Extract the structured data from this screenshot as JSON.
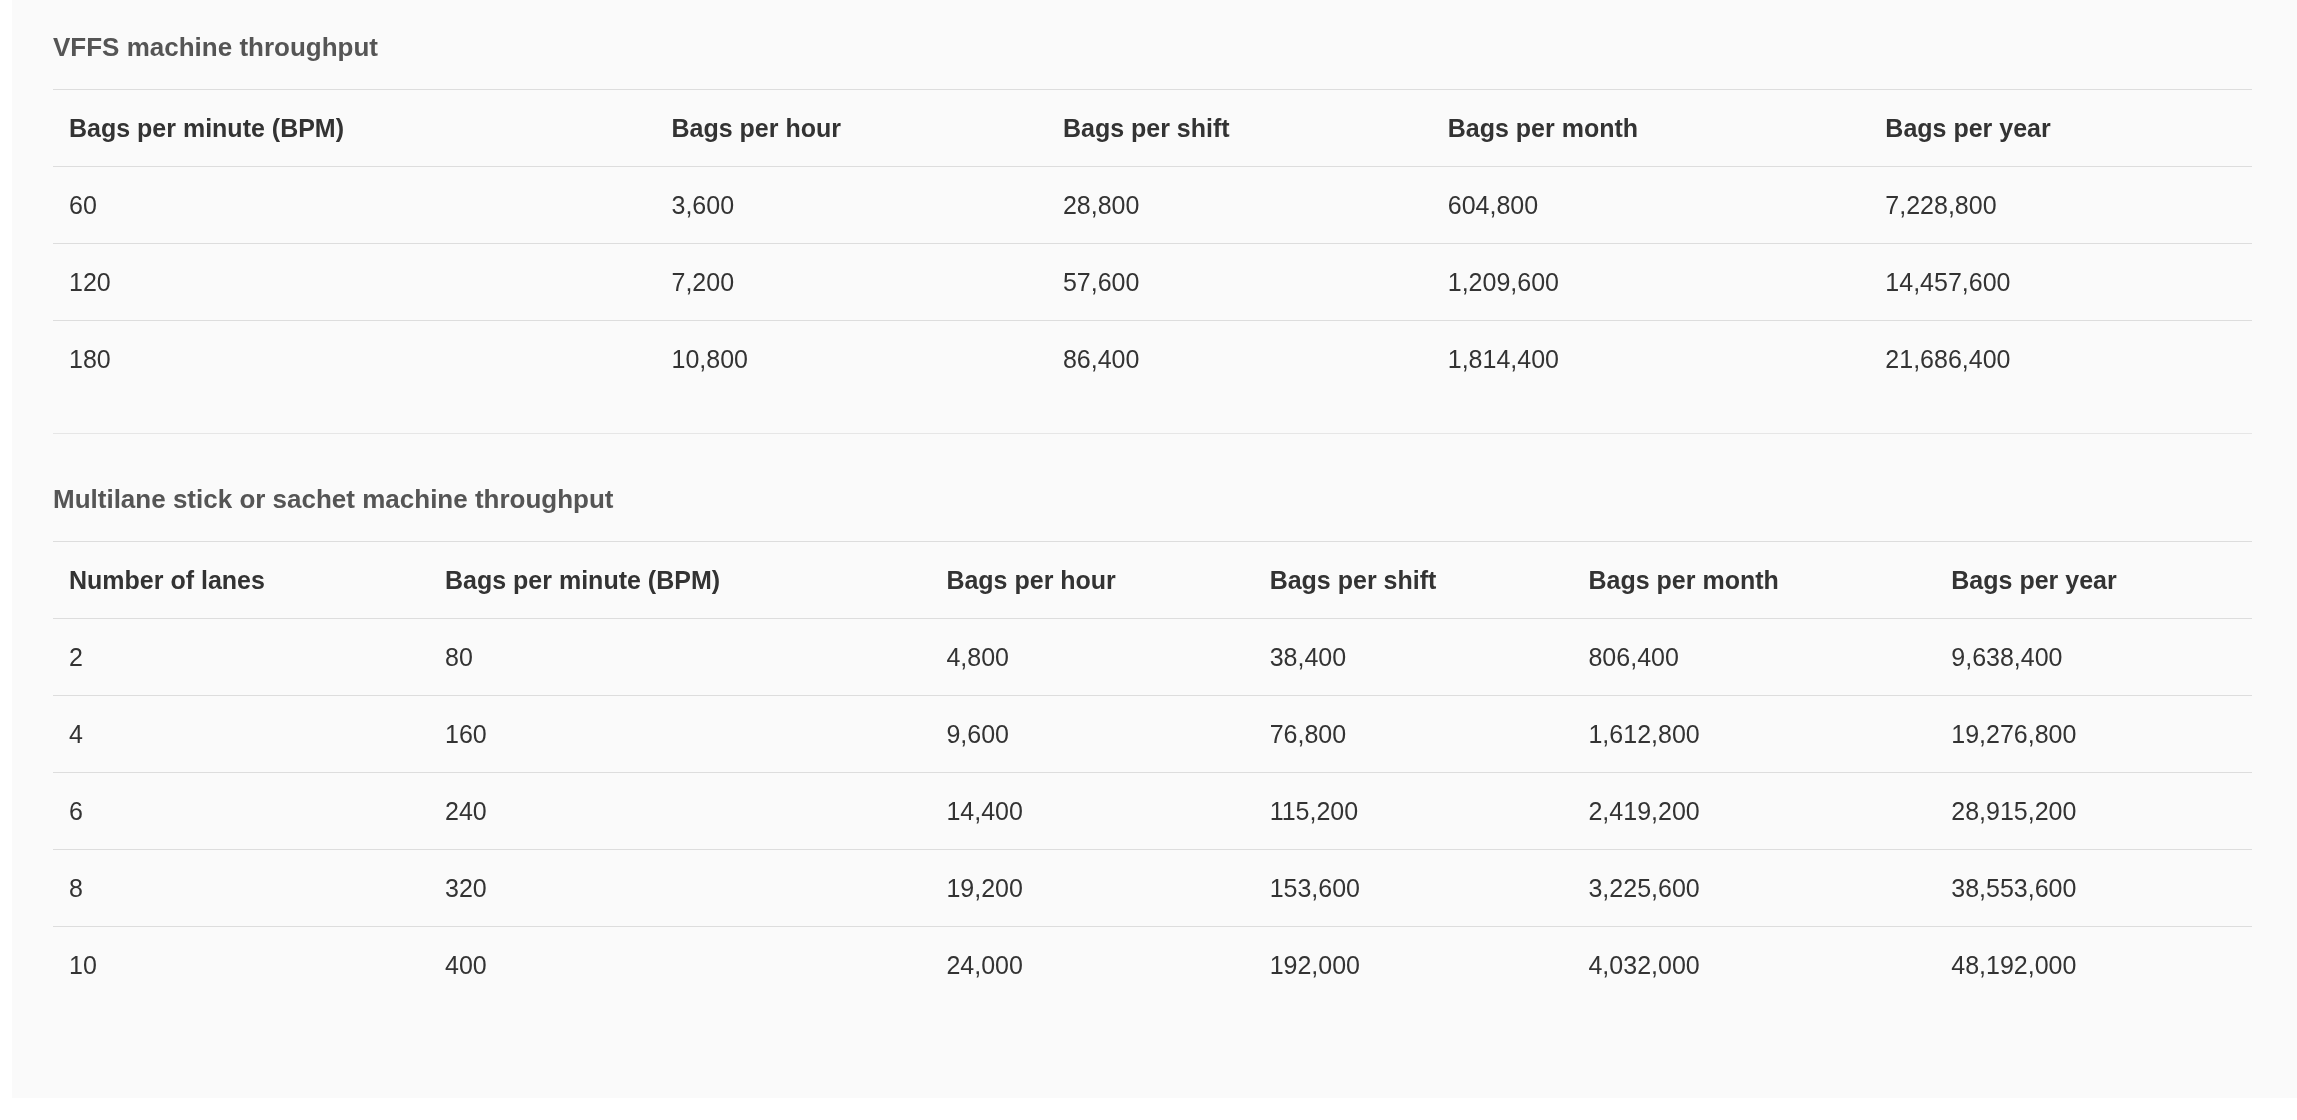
{
  "sections": [
    {
      "title": "VFFS machine throughput",
      "table": {
        "columns": [
          "Bags per minute (BPM)",
          "Bags per hour",
          "Bags per shift",
          "Bags per month",
          "Bags per year"
        ],
        "rows": [
          [
            "60",
            "3,600",
            "28,800",
            "604,800",
            "7,228,800"
          ],
          [
            "120",
            "7,200",
            "57,600",
            "1,209,600",
            "14,457,600"
          ],
          [
            "180",
            "10,800",
            "86,400",
            "1,814,400",
            "21,686,400"
          ]
        ]
      }
    },
    {
      "title": "Multilane stick or sachet machine throughput",
      "table": {
        "columns": [
          "Number of lanes",
          "Bags per minute (BPM)",
          "Bags per hour",
          "Bags per shift",
          "Bags per month",
          "Bags per year"
        ],
        "rows": [
          [
            "2",
            "80",
            "4,800",
            "38,400",
            "806,400",
            "9,638,400"
          ],
          [
            "4",
            "160",
            "9,600",
            "76,800",
            "1,612,800",
            "19,276,800"
          ],
          [
            "6",
            "240",
            "14,400",
            "115,200",
            "2,419,200",
            "28,915,200"
          ],
          [
            "8",
            "320",
            "19,200",
            "153,600",
            "3,225,600",
            "38,553,600"
          ],
          [
            "10",
            "400",
            "24,000",
            "192,000",
            "4,032,000",
            "48,192,000"
          ]
        ]
      }
    }
  ]
}
